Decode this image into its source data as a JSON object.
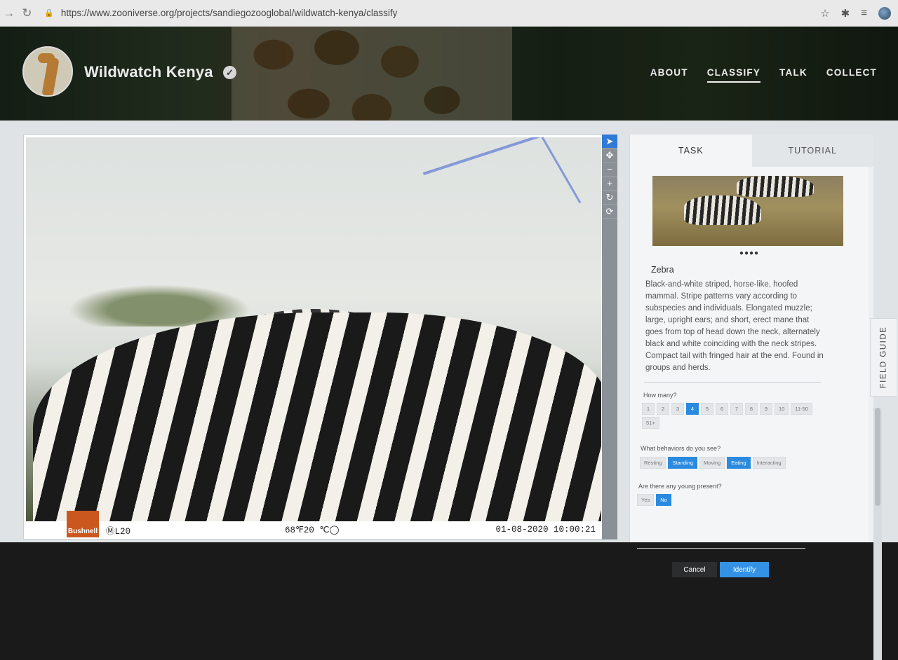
{
  "browser": {
    "url": "https://www.zooniverse.org/projects/sandiegozooglobal/wildwatch-kenya/classify"
  },
  "project": {
    "title": "Wildwatch Kenya",
    "nav": [
      "ABOUT",
      "CLASSIFY",
      "TALK",
      "COLLECT"
    ],
    "active_nav": "CLASSIFY"
  },
  "subject": {
    "camera_brand": "Bushnell",
    "camera_id": "ⓂL20",
    "temperature": "68℉20 ℃◯",
    "timestamp": "01-08-2020 10:00:21"
  },
  "toolbar": {
    "tools": [
      "pointer-icon",
      "move-icon",
      "zoom-out-icon",
      "zoom-in-icon",
      "rotate-icon",
      "reset-icon"
    ],
    "tool_glyphs": [
      "➤",
      "✥",
      "−",
      "+",
      "↻",
      "⟳"
    ],
    "active_tool": "pointer-icon"
  },
  "task_panel": {
    "tabs": [
      "TASK",
      "TUTORIAL"
    ],
    "active_tab": "TASK",
    "field_guide_label": "FIELD GUIDE",
    "species_name": "Zebra",
    "species_description": "Black-and-white striped, horse-like, hoofed mammal. Stripe patterns vary according to subspecies and individuals. Elongated muzzle; large, upright ears; and short, erect mane that goes from top of head down the neck, alternately black and white coinciding with the neck stripes. Compact tail with fringed hair at the end. Found in groups and herds.",
    "carousel_dots": "●●●●",
    "questions": {
      "how_many": {
        "label": "How many?",
        "options": [
          "1",
          "2",
          "3",
          "4",
          "5",
          "6",
          "7",
          "8",
          "9",
          "10",
          "11-50",
          "51+"
        ],
        "selected": [
          "4"
        ]
      },
      "behaviors": {
        "label": "What behaviors do you see?",
        "options": [
          "Resting",
          "Standing",
          "Moving",
          "Eating",
          "Interacting"
        ],
        "selected": [
          "Standing",
          "Eating"
        ]
      },
      "young": {
        "label": "Are there any young present?",
        "options": [
          "Yes",
          "No"
        ],
        "selected": [
          "No"
        ]
      }
    },
    "buttons": {
      "cancel": "Cancel",
      "identify": "Identify"
    }
  },
  "colors": {
    "accent": "#2a8ae0",
    "cancel_button": "#2c2d2e"
  }
}
